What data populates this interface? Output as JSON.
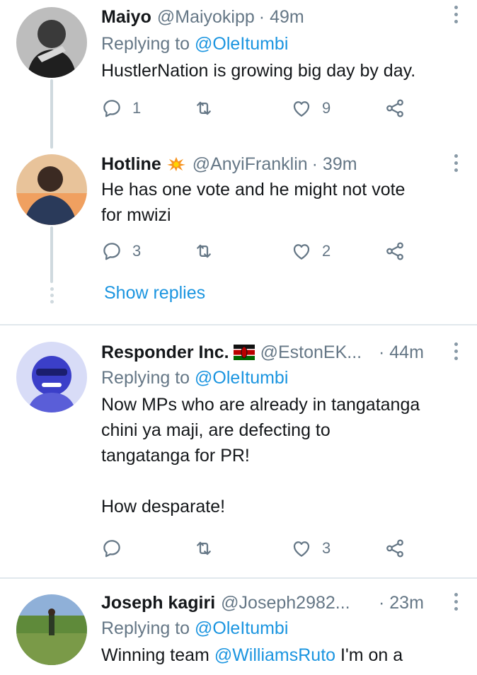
{
  "tweets": [
    {
      "name": "Maiyo",
      "handle": "@Maiyokipp",
      "time": "· 49m",
      "replying_prefix": "Replying to",
      "replying_to": "@OleItumbi",
      "text": "HustlerNation is growing big day by day.",
      "replies": "1",
      "retweets": "",
      "likes": "9"
    },
    {
      "name": "Hotline",
      "badge": "collision-emoji",
      "handle": "@AnyiFranklin",
      "time": "· 39m",
      "text_line1": "He has one vote and he might not vote",
      "text_line2": "for mwizi",
      "replies": "3",
      "retweets": "",
      "likes": "2"
    },
    {
      "name": "Responder Inc.",
      "badge": "kenya-flag-emoji",
      "handle": "@EstonEK...",
      "time": "· 44m",
      "replying_prefix": "Replying to",
      "replying_to": "@OleItumbi",
      "text_line1": "Now MPs who are already in tangatanga",
      "text_line2": "chini ya maji, are defecting to",
      "text_line3": "tangatanga for PR!",
      "text_line4": "How desparate!",
      "replies": "",
      "retweets": "",
      "likes": "3"
    },
    {
      "name": "Joseph kagiri",
      "handle": "@Joseph2982...",
      "time": "· 23m",
      "replying_prefix": "Replying to",
      "replying_to": "@OleItumbi",
      "text_start": "Winning team",
      "text_mention": "@WilliamsRuto",
      "text_end": "I'm on a"
    }
  ],
  "show_replies": "Show replies",
  "colors": {
    "link": "#1b95e0",
    "muted": "#657786",
    "divider": "#e1e8ed",
    "thread": "#cfd9de"
  },
  "icons": [
    "reply-icon",
    "retweet-icon",
    "like-icon",
    "share-icon",
    "more-icon"
  ]
}
